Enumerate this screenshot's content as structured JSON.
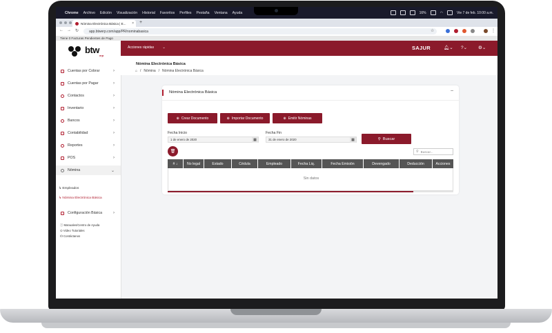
{
  "menubar": {
    "app": "Chrome",
    "items": [
      "Archivo",
      "Edición",
      "Visualización",
      "Historial",
      "Favoritos",
      "Perfiles",
      "Pestaña",
      "Ventana",
      "Ayuda"
    ],
    "battery": "16%",
    "datetime": "Vie 7 de feb.  10:00 a.m."
  },
  "browser": {
    "tab_title": "Nómina Electrónica Básica | E...",
    "url": "app.btwerp.com/app/PR/nominabasica"
  },
  "notification": {
    "text": "Tiene 0 Facturas Pendientes de Pago"
  },
  "logo": {
    "text": "btw",
    "sub": "erp"
  },
  "sidebar": {
    "items": [
      {
        "label": "Cuentas por Cobrar"
      },
      {
        "label": "Cuentas por Pagar"
      },
      {
        "label": "Contactos"
      },
      {
        "label": "Inventario"
      },
      {
        "label": "Bancos"
      },
      {
        "label": "Contabilidad"
      },
      {
        "label": "Reportes"
      },
      {
        "label": "POS"
      },
      {
        "label": "Nómina"
      }
    ],
    "subitems": [
      {
        "label": "↳ Empleados"
      },
      {
        "label": "↳ Nómina Electrónica Básica"
      }
    ],
    "config": {
      "label": "Configuración Básica"
    },
    "help": [
      {
        "label": "ⓘ Manuales/Centro de Ayuda"
      },
      {
        "label": "⊙ Video Tutoriales"
      },
      {
        "label": "☊ Contáctanos"
      }
    ]
  },
  "header": {
    "quick_actions": "Acciones rápidas",
    "user": "SAJUR"
  },
  "page": {
    "title": "Nómina Electrónica Básica",
    "breadcrumb": [
      "Nómina",
      "Nómina Electrónica Básica"
    ]
  },
  "card": {
    "title": "Nómina Electrónica Básica",
    "buttons": {
      "create": "Crear Documento",
      "import": "Importar Documento",
      "emit": "Emitir Nóminas"
    },
    "filters": {
      "start_label": "Fecha Inicio",
      "start_value": "1 de enero de 2020",
      "end_label": "Fecha Fin",
      "end_value": "31 de enero de 2020",
      "search_button": "Buscar"
    },
    "table_search_placeholder": "Buscar...",
    "table": {
      "columns": [
        "#",
        "No legal",
        "Estado",
        "Cédula",
        "Empleado",
        "Fecha Liq.",
        "Fecha Emisión",
        "Devengado",
        "Deducción",
        "Acciones"
      ],
      "empty_text": "Sin datos",
      "scroll_progress": 0.86
    }
  },
  "colors": {
    "brand": "#8b1a2b",
    "accent": "#b01c2e",
    "table_header": "#555555"
  }
}
